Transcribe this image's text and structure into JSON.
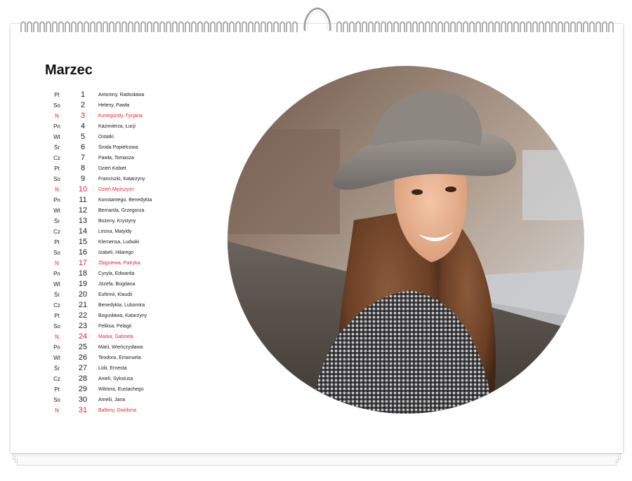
{
  "calendar": {
    "month": "Marzec",
    "days": [
      {
        "wd": "Pt",
        "d": "1",
        "name": "Antoniny, Radosława",
        "sun": false
      },
      {
        "wd": "So",
        "d": "2",
        "name": "Heleny, Pawła",
        "sun": false
      },
      {
        "wd": "N",
        "d": "3",
        "name": "Kunegundy, Tycjana",
        "sun": true
      },
      {
        "wd": "Pn",
        "d": "4",
        "name": "Kazimierza, Łucji",
        "sun": false
      },
      {
        "wd": "Wt",
        "d": "5",
        "name": "Ostatki",
        "sun": false
      },
      {
        "wd": "Śr",
        "d": "6",
        "name": "Środa Popielcowa",
        "sun": false
      },
      {
        "wd": "Cz",
        "d": "7",
        "name": "Pawła, Tomasza",
        "sun": false
      },
      {
        "wd": "Pt",
        "d": "8",
        "name": "Dzień Kobiet",
        "sun": false
      },
      {
        "wd": "So",
        "d": "9",
        "name": "Franciszki, Katarzyny",
        "sun": false
      },
      {
        "wd": "N",
        "d": "10",
        "name": "Dzień Mężczyzn",
        "sun": true
      },
      {
        "wd": "Pn",
        "d": "11",
        "name": "Konstantego, Benedykta",
        "sun": false
      },
      {
        "wd": "Wt",
        "d": "12",
        "name": "Bernarda, Grzegorza",
        "sun": false
      },
      {
        "wd": "Śr",
        "d": "13",
        "name": "Bożeny, Krystyny",
        "sun": false
      },
      {
        "wd": "Cz",
        "d": "14",
        "name": "Leona, Matyldy",
        "sun": false
      },
      {
        "wd": "Pt",
        "d": "15",
        "name": "Klemensa, Ludwiki",
        "sun": false
      },
      {
        "wd": "So",
        "d": "16",
        "name": "Izabeli, Hilarego",
        "sun": false
      },
      {
        "wd": "N",
        "d": "17",
        "name": "Zbigniewa, Patryka",
        "sun": true
      },
      {
        "wd": "Pn",
        "d": "18",
        "name": "Cyryla, Edwarda",
        "sun": false
      },
      {
        "wd": "Wt",
        "d": "19",
        "name": "Józefa, Bogdana",
        "sun": false
      },
      {
        "wd": "Śr",
        "d": "20",
        "name": "Eufemii, Klaudii",
        "sun": false
      },
      {
        "wd": "Cz",
        "d": "21",
        "name": "Benedykta, Lubomira",
        "sun": false
      },
      {
        "wd": "Pt",
        "d": "22",
        "name": "Bogusława, Katarzyny",
        "sun": false
      },
      {
        "wd": "So",
        "d": "23",
        "name": "Feliksa, Pelagii",
        "sun": false
      },
      {
        "wd": "N",
        "d": "24",
        "name": "Marka, Gabriela",
        "sun": true
      },
      {
        "wd": "Pn",
        "d": "25",
        "name": "Marii, Wieńczysława",
        "sun": false
      },
      {
        "wd": "Wt",
        "d": "26",
        "name": "Teodora, Emanuela",
        "sun": false
      },
      {
        "wd": "Śr",
        "d": "27",
        "name": "Lidii, Ernesta",
        "sun": false
      },
      {
        "wd": "Cz",
        "d": "28",
        "name": "Anieli, Sykstusa",
        "sun": false
      },
      {
        "wd": "Pt",
        "d": "29",
        "name": "Wiktora, Eustachego",
        "sun": false
      },
      {
        "wd": "So",
        "d": "30",
        "name": "Amelii, Jana",
        "sun": false
      },
      {
        "wd": "N",
        "d": "31",
        "name": "Balbiny, Gwidona",
        "sun": true
      }
    ]
  },
  "colors": {
    "sunday": "#e3262f",
    "text": "#1a1a1a",
    "page": "#ffffff"
  }
}
